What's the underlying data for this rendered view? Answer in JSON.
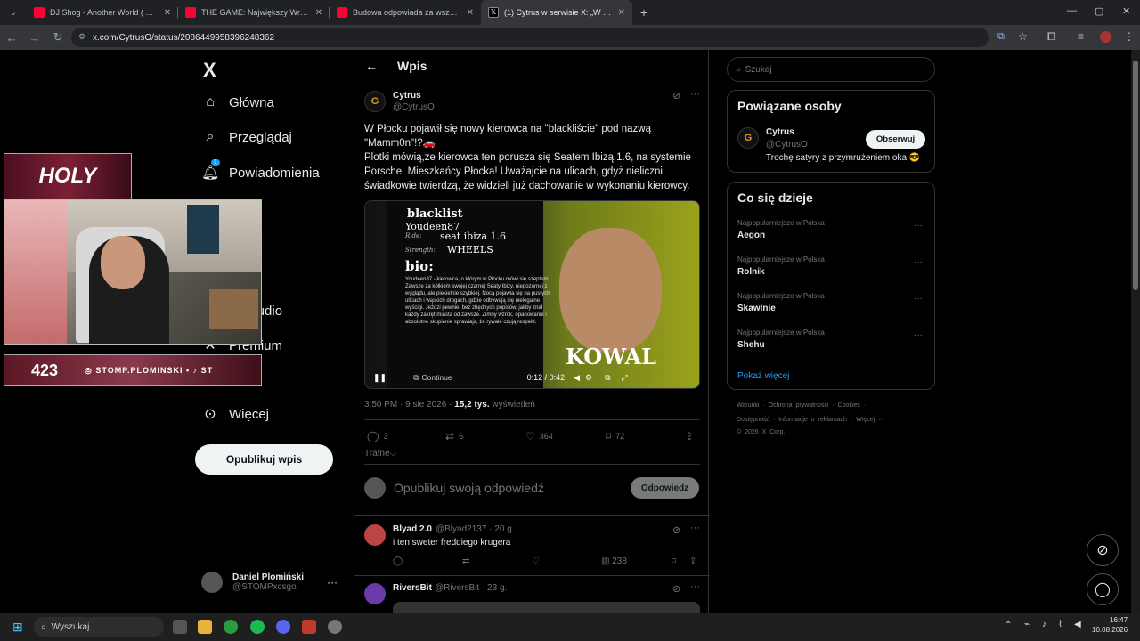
{
  "browser": {
    "tabs": [
      {
        "title": "DJ Shog - Another World ( Polo...",
        "color": "#ff0033"
      },
      {
        "title": "THE GAME: Największy Wrogowie...",
        "color": "#ff0033"
      },
      {
        "title": "Budowa odpowiada za wszystko...",
        "color": "#ff0033"
      },
      {
        "title": "(1) Cytrus w serwisie X: „W P...",
        "color": "#000000"
      }
    ],
    "new_tab": "+",
    "url": "x.com/CytrusO/status/2086449958396248362"
  },
  "sidebar": {
    "logo": "X",
    "nav": [
      {
        "label": "Główna",
        "icon": "home-icon"
      },
      {
        "label": "Przeglądaj",
        "icon": "search-icon"
      },
      {
        "label": "Powiadomienia",
        "icon": "bell-icon",
        "badge": "1"
      },
      {
        "label": "dki",
        "icon": "bookmark-icon"
      },
      {
        "label": "or Studio",
        "icon": "studio-icon"
      },
      {
        "label": "Premium",
        "icon": "premium-icon"
      },
      {
        "label": "Więcej",
        "icon": "more-icon"
      }
    ],
    "post_button": "Opublikuj wpis",
    "account": {
      "name": "Daniel Plomiński",
      "handle": "@STOMPxcsgo",
      "dots": "···"
    }
  },
  "main": {
    "header": "Wpis",
    "tweet": {
      "author": "Cytrus",
      "handle": "@CytrusO",
      "avatar_letter": "G",
      "text": "W Płocku pojawił się nowy kierowca na \"blackliście\" pod nazwą \"Mamm0n\"!?🚗\nPlotki mówią,że kierowca ten porusza się Seatem Ibizą 1.6, na systemie Porsche. Mieszkańcy Płocka! Uważajcie na ulicach, gdyż nieliczni świadkowie twierdzą, że widzieli już dachowanie w wykonaniu kierowcy.",
      "media": {
        "title": "blacklist",
        "user": "Youdeen87",
        "ride_label": "Ride:",
        "ride": "seat ibiza 1.6",
        "strength_label": "Strength:",
        "strength": "WHEELS",
        "bio_label": "bio:",
        "bio": "Youdeen87 - kierowca, o którym w Płocku mówi się szeptem. Zawsze za kółkiem swojej czarnej Seaty Ibizy, niepozornej z wyglądu, ale piekielnie szybkiej. Nocą pojawia się na pustych ulicach i wąskich drogach, gdzie odbywają się nielegalne wyścigi. Jeździ pewnie, bez zbędnych popisów, jakby znał każdy zakręt miasta od zawsze. Zimny wzrok, opanowanie i absolutne skupienie sprawiają, że rywale czują respekt.",
        "overlay": "KOWAL",
        "continue": "Continue",
        "time": "0:12 / 0:42",
        "progress": 0.29
      },
      "time": "3:50 PM · 9 sie 2026 · ",
      "views_num": "15,2 tys.",
      "views_label": " wyświetleń",
      "stats": {
        "replies": "3",
        "reposts": "6",
        "likes": "364",
        "bookmarks": "72"
      }
    },
    "sort_label": "Trafne⌵",
    "reply_placeholder": "Opublikuj swoją odpowiedź",
    "reply_button": "Odpowiedz",
    "replies": [
      {
        "name": "Blyad 2.0",
        "handle": "@Blyad2137 · 20 g.",
        "text": "i ten sweter freddiego krugera",
        "views": "238"
      },
      {
        "name": "RiversBit",
        "handle": "@RiversBit · 23 g.",
        "text": ""
      }
    ]
  },
  "right": {
    "search_placeholder": "Szukaj",
    "related_title": "Powiązane osoby",
    "related": {
      "name": "Cytrus",
      "handle": "@CytrusO",
      "bio": "Trochę satyry z przymrużeniem oka 😎",
      "follow": "Obserwuj"
    },
    "trends_title": "Co się dzieje",
    "trends": [
      {
        "category": "Najpopularniejsze w Polska",
        "name": "Aegon"
      },
      {
        "category": "Najpopularniejsze w Polska",
        "name": "Rolnik"
      },
      {
        "category": "Najpopularniejsze w Polska",
        "name": "Skawinie"
      },
      {
        "category": "Najpopularniejsze w Polska",
        "name": "Shehu"
      }
    ],
    "show_more": "Pokaż więcej",
    "footer1": "Warunki · Ochrona prywatności · Cookies ·",
    "footer2": "Dostępność · Informacje o reklamach · Więcej ···",
    "footer3": "© 2026 X Corp."
  },
  "stream": {
    "logo": "HOLY",
    "stat": "423",
    "handle": "◎ STOMP.PLOMINSKI • ♪ ST"
  },
  "taskbar": {
    "search": "Wyszukaj",
    "time": "16:47",
    "date": "10.08.2026"
  }
}
